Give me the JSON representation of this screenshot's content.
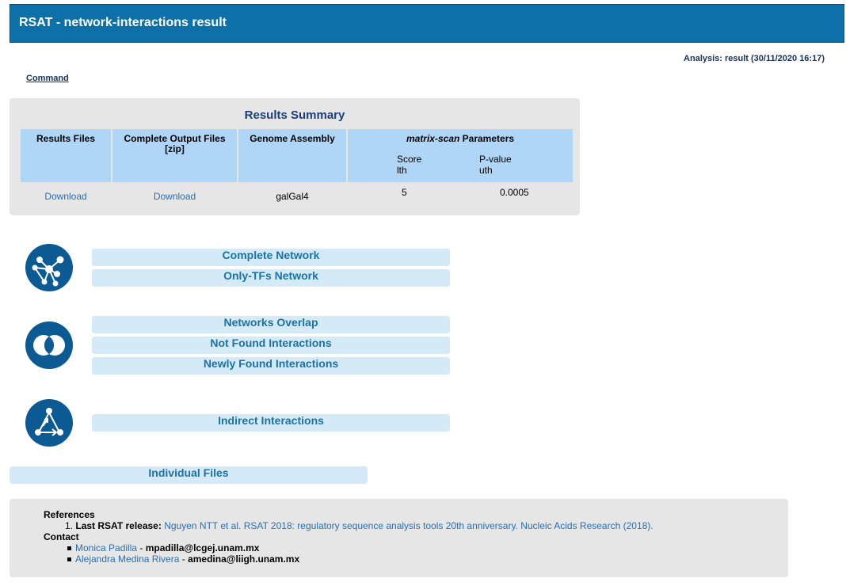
{
  "header": {
    "title": "RSAT - network-interactions result"
  },
  "analysis": "Analysis: result (30/11/2020 16:17)",
  "command_link": "Command",
  "summary": {
    "title": "Results Summary",
    "columns": {
      "results_files": "Results Files",
      "complete_output": "Complete Output Files [zip]",
      "genome": "Genome Assembly",
      "params_title_em": "matrix-scan",
      "params_title_rest": " Parameters",
      "score_label": "Score",
      "score_sub": "lth",
      "pvalue_label": "P-value",
      "pvalue_sub": "uth"
    },
    "row": {
      "results_files": "Download",
      "complete_output": "Download",
      "genome": "galGal4",
      "score": "5",
      "pvalue": "0.0005"
    }
  },
  "sections": {
    "complete_network": "Complete Network",
    "only_tfs_network": "Only-TFs Network",
    "networks_overlap": "Networks Overlap",
    "not_found": "Not Found Interactions",
    "newly_found": "Newly Found Interactions",
    "indirect": "Indirect Interactions",
    "individual_files": "Individual Files"
  },
  "icons": {
    "network": "network-graph-icon",
    "overlap": "venn-overlap-icon",
    "indirect": "triangle-graph-icon"
  },
  "references": {
    "heading": "References",
    "item_number": "1.",
    "item_bold": "Last RSAT release:",
    "item_link": "Nguyen NTT et al. RSAT 2018: regulatory sequence analysis tools 20th anniversary. Nucleic Acids Research (2018).",
    "contact_heading": "Contact",
    "contacts": [
      {
        "name": "Monica Padilla",
        "sep": " - ",
        "email": "mpadilla@lcgej.unam.mx"
      },
      {
        "name": "Alejandra Medina Rivera",
        "sep": " - ",
        "email": "amedina@liigh.unam.mx"
      }
    ]
  },
  "colors": {
    "header_bg": "#0e70a8",
    "button_bg": "#d4ebf7",
    "button_text": "#1a72a8",
    "icon_bg": "#0b5a93",
    "panel_bg": "#e6e6e6",
    "table_head_bg": "#b0d6f7"
  }
}
